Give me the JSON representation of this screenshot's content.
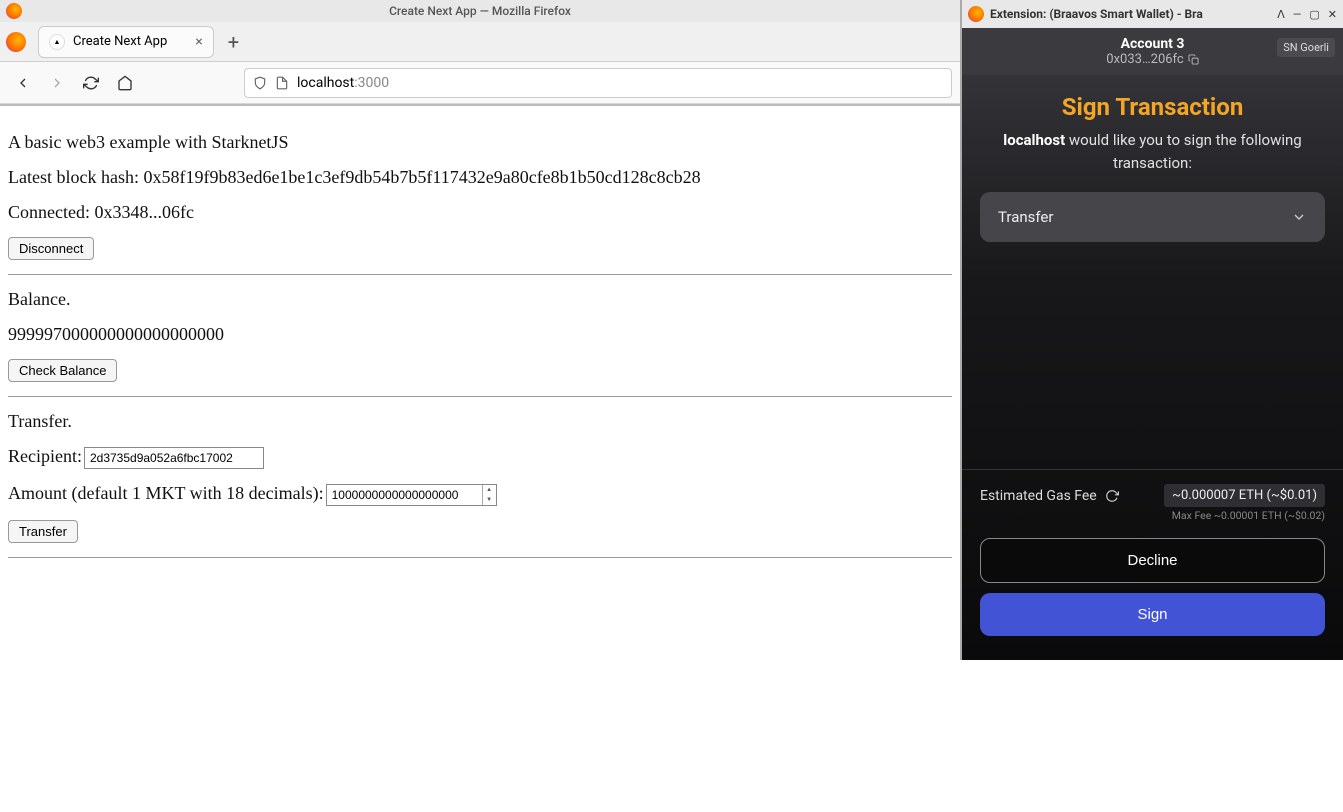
{
  "main_window": {
    "title": "Create Next App — Mozilla Firefox",
    "tab": {
      "label": "Create Next App"
    },
    "url": {
      "host": "localhost",
      "port": ":3000"
    }
  },
  "page": {
    "intro": "A basic web3 example with StarknetJS",
    "block_hash_label": "Latest block hash: ",
    "block_hash": "0x58f19f9b83ed6e1be1c3ef9db54b7b5f117432e9a80cfe8b1b50cd128c8cb28",
    "connected_label": "Connected: ",
    "connected_addr": "0x3348...06fc",
    "disconnect_btn": "Disconnect",
    "balance_heading": "Balance.",
    "balance_value": "999997000000000000000000",
    "check_balance_btn": "Check Balance",
    "transfer_heading": "Transfer.",
    "recipient_label": "Recipient:",
    "recipient_value": "2d3735d9a052a6fbc17002",
    "amount_label": "Amount (default 1 MKT with 18 decimals):",
    "amount_value": "1000000000000000000",
    "transfer_btn": "Transfer"
  },
  "ext_window": {
    "title": "Extension: (Braavos Smart Wallet) - Bra",
    "account_name": "Account 3",
    "account_addr": "0x033…206fc",
    "network": "SN Goerli",
    "sign_title": "Sign Transaction",
    "sign_desc_host": "localhost",
    "sign_desc_rest": " would like you to sign the following transaction:",
    "tx_label": "Transfer",
    "gas_label": "Estimated Gas Fee",
    "gas_value": "~0.000007 ETH (~$0.01)",
    "max_fee": "Max Fee ~0.00001 ETH (~$0.02)",
    "decline_btn": "Decline",
    "sign_btn": "Sign"
  }
}
